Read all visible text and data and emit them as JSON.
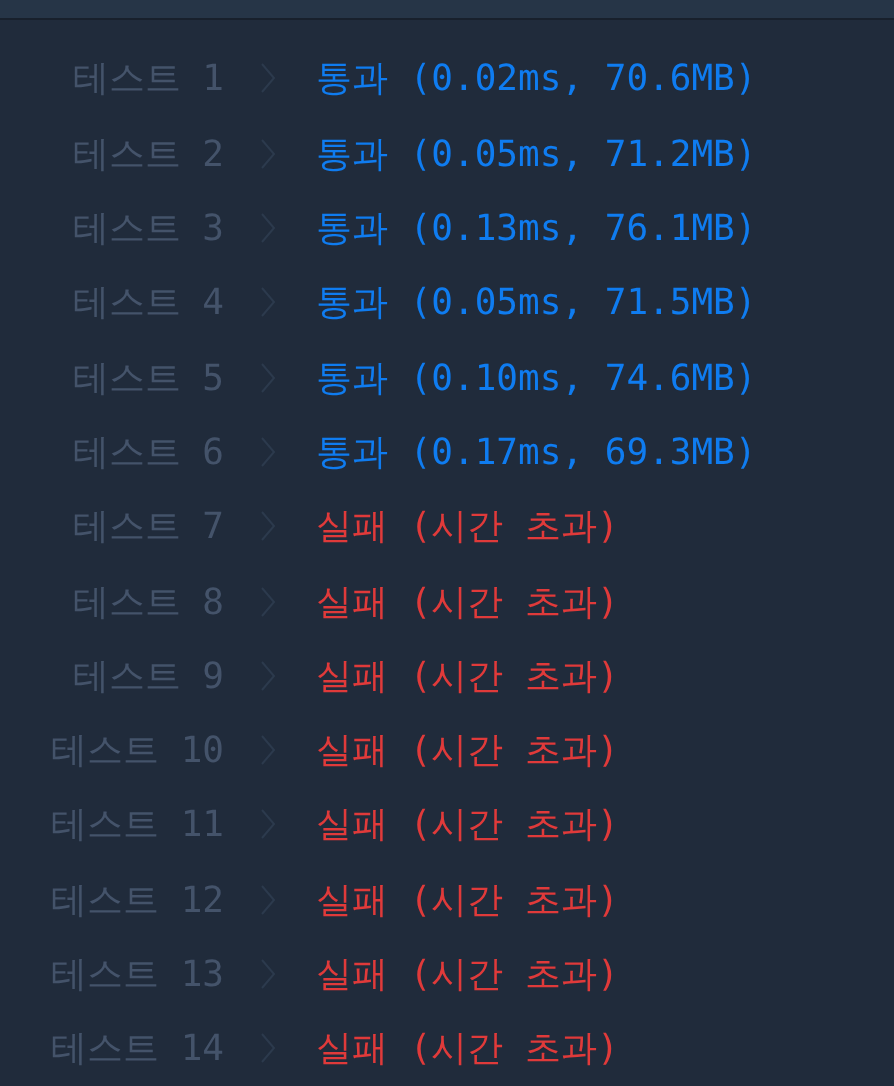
{
  "results": [
    {
      "label": "테스트 1",
      "kind": "pass",
      "result": "통과 (0.02ms, 70.6MB)"
    },
    {
      "label": "테스트 2",
      "kind": "pass",
      "result": "통과 (0.05ms, 71.2MB)"
    },
    {
      "label": "테스트 3",
      "kind": "pass",
      "result": "통과 (0.13ms, 76.1MB)"
    },
    {
      "label": "테스트 4",
      "kind": "pass",
      "result": "통과 (0.05ms, 71.5MB)"
    },
    {
      "label": "테스트 5",
      "kind": "pass",
      "result": "통과 (0.10ms, 74.6MB)"
    },
    {
      "label": "테스트 6",
      "kind": "pass",
      "result": "통과 (0.17ms, 69.3MB)"
    },
    {
      "label": "테스트 7",
      "kind": "fail",
      "result": "실패 (시간 초과)"
    },
    {
      "label": "테스트 8",
      "kind": "fail",
      "result": "실패 (시간 초과)"
    },
    {
      "label": "테스트 9",
      "kind": "fail",
      "result": "실패 (시간 초과)"
    },
    {
      "label": "테스트 10",
      "kind": "fail",
      "result": "실패 (시간 초과)"
    },
    {
      "label": "테스트 11",
      "kind": "fail",
      "result": "실패 (시간 초과)"
    },
    {
      "label": "테스트 12",
      "kind": "fail",
      "result": "실패 (시간 초과)"
    },
    {
      "label": "테스트 13",
      "kind": "fail",
      "result": "실패 (시간 초과)"
    },
    {
      "label": "테스트 14",
      "kind": "fail",
      "result": "실패 (시간 초과)"
    }
  ]
}
